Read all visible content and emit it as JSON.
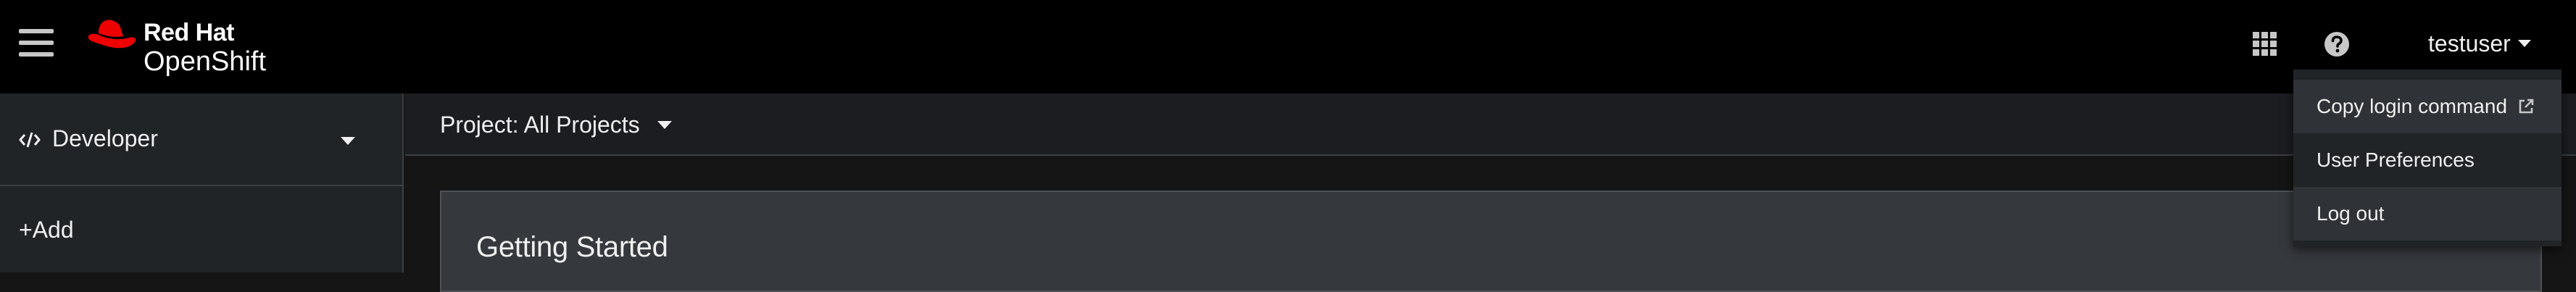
{
  "masthead": {
    "brand_line1": "Red Hat",
    "brand_line2": "OpenShift",
    "apps_icon": "grid-icon",
    "help_icon": "question-circle-icon",
    "username": "testuser"
  },
  "user_menu": {
    "items": [
      {
        "label": "Copy login command",
        "icon": "external-link-icon"
      },
      {
        "label": "User Preferences"
      },
      {
        "label": "Log out"
      }
    ]
  },
  "sidebar": {
    "perspective": {
      "label": "Developer",
      "icon": "code-icon"
    },
    "items": [
      {
        "label": "+Add"
      }
    ]
  },
  "project_bar": {
    "label": "Project: All Projects"
  },
  "content": {
    "card_title": "Getting Started"
  },
  "colors": {
    "masthead_bg": "#000000",
    "brand_red": "#ee0000",
    "sidebar_bg": "#212427",
    "page_bg": "#151515",
    "card_bg": "#35383c"
  }
}
